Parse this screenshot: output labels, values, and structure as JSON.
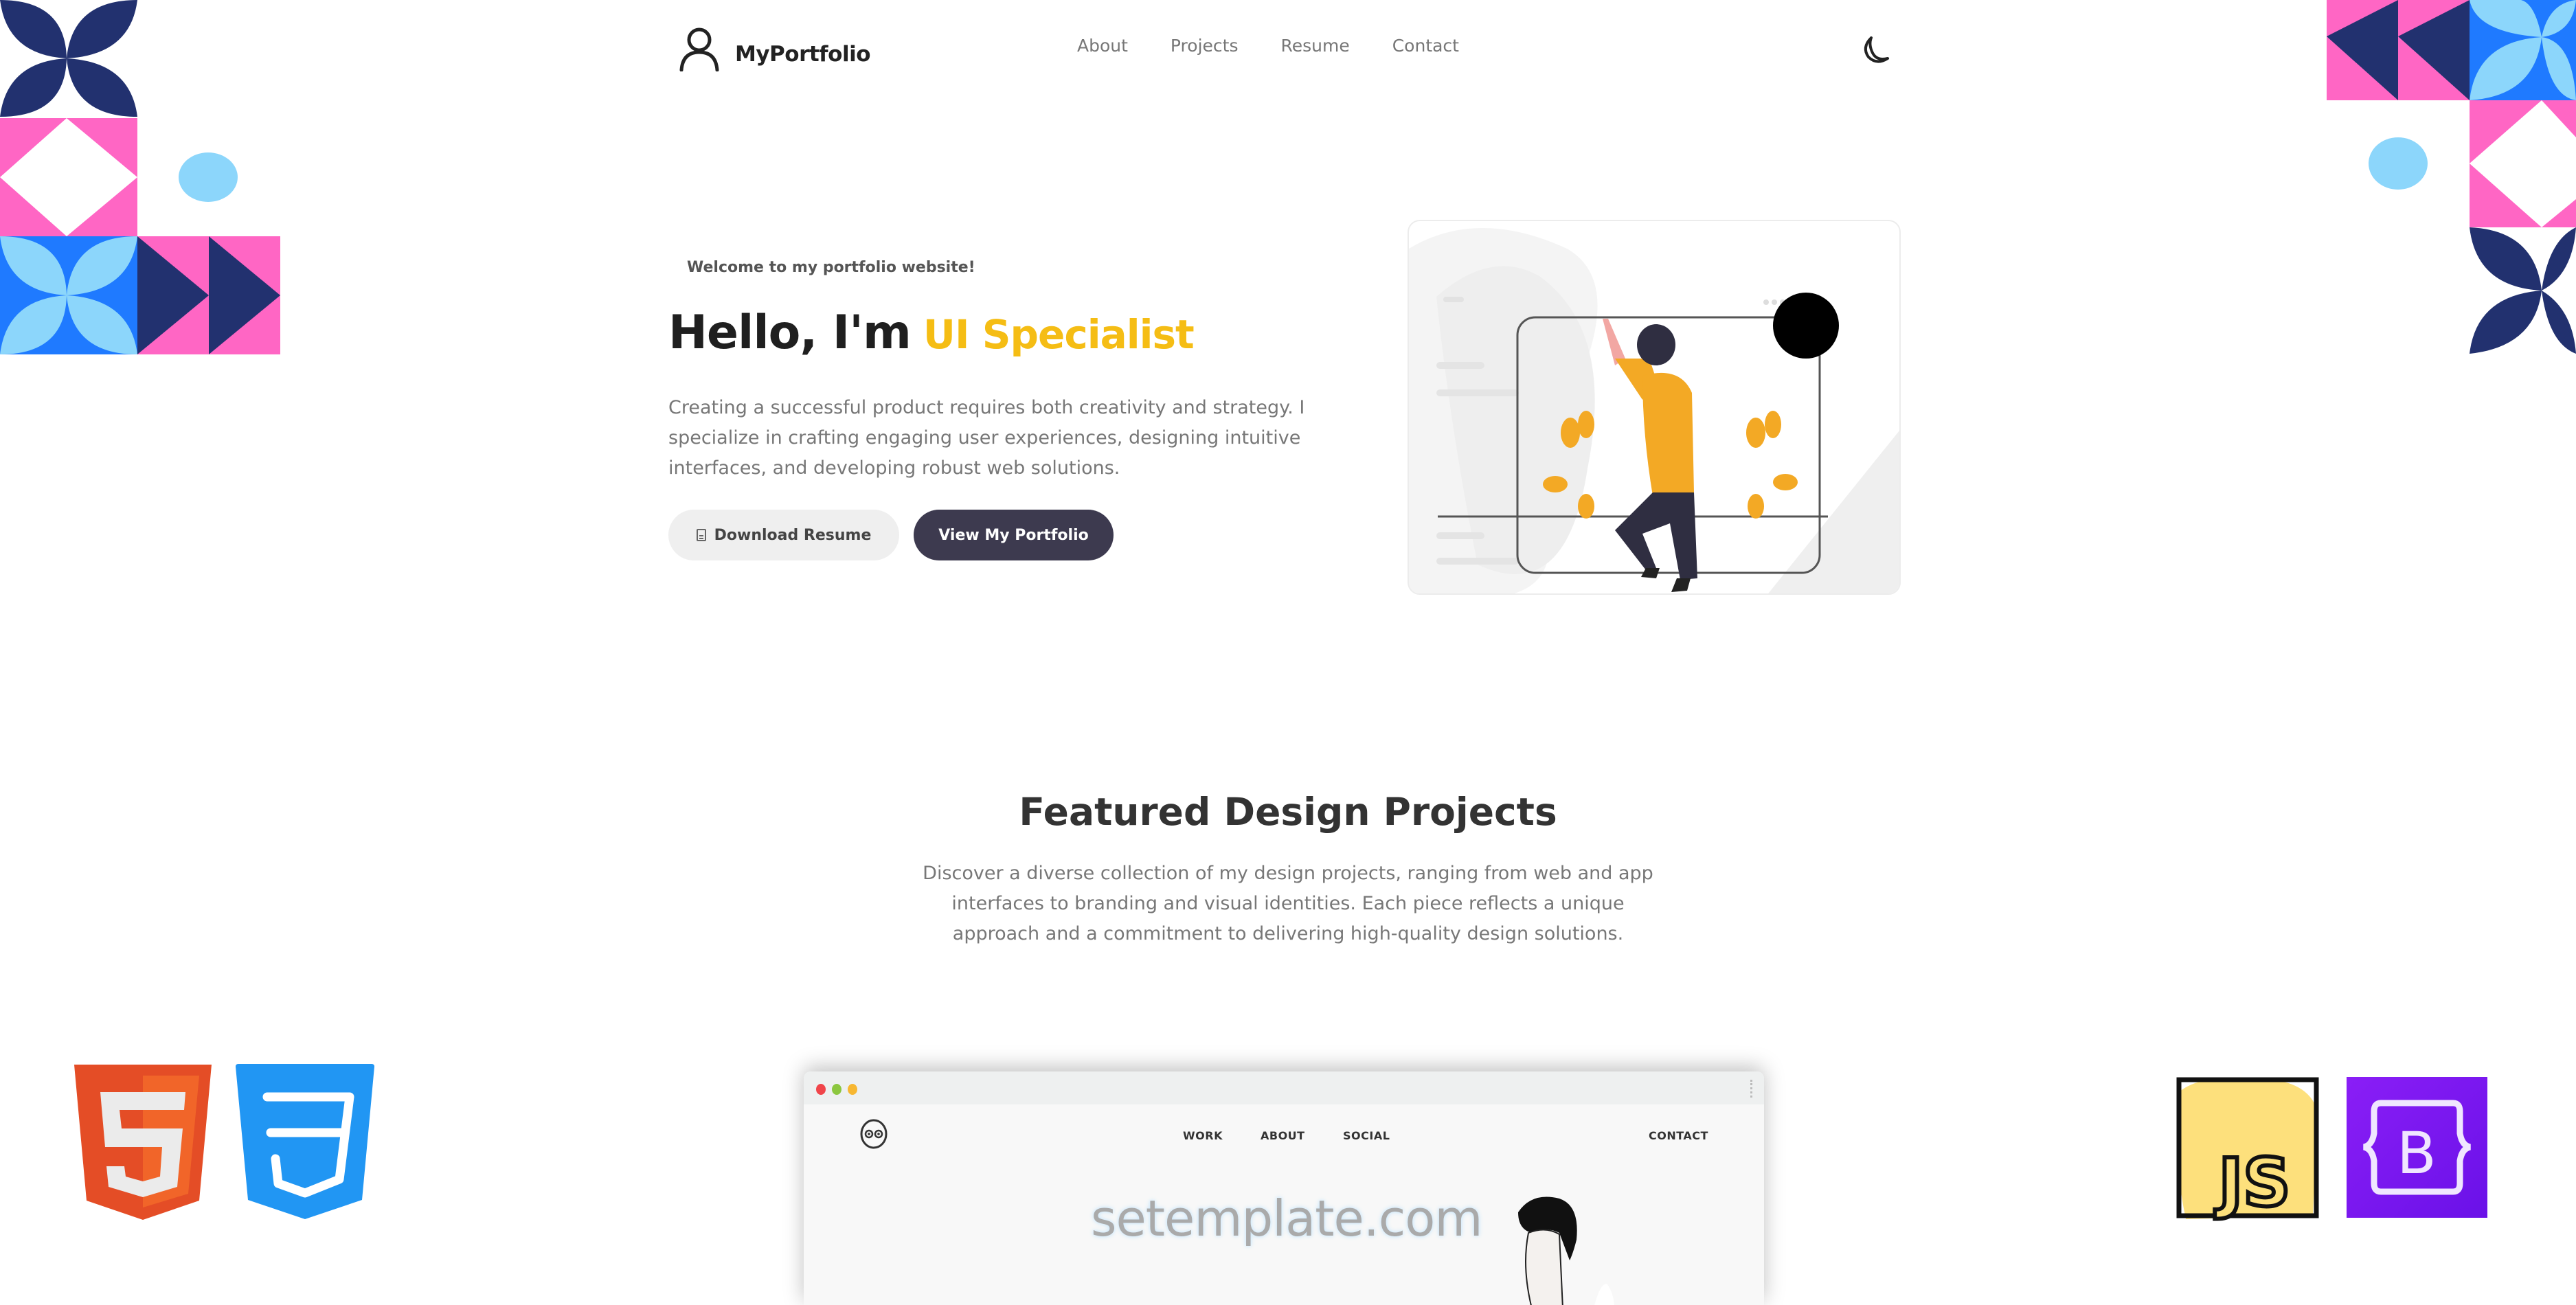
{
  "nav": {
    "brand": "MyPortfolio",
    "links": [
      "About",
      "Projects",
      "Resume",
      "Contact"
    ],
    "theme_toggle_icon": "moon-icon",
    "logo_icon": "user-icon"
  },
  "hero": {
    "welcome": "Welcome to my portfolio website!",
    "title_prefix": "Hello, I'm",
    "title_accent": "UI Specialist",
    "description": "Creating a successful product requires both creativity and strategy. I specialize in crafting engaging user experiences, designing intuitive interfaces, and developing robust web solutions.",
    "download_button": "Download Resume",
    "download_icon": "file-icon",
    "view_button": "View My Portfolio",
    "accent_color": "#f5bd14"
  },
  "featured": {
    "title": "Featured Design Projects",
    "description": "Discover a diverse collection of my design projects, ranging from web and app interfaces to branding and visual identities. Each piece reflects a unique approach and a commitment to delivering high-quality design solutions."
  },
  "mockup": {
    "nav_links": [
      "WORK",
      "ABOUT",
      "SOCIAL"
    ],
    "contact": "CONTACT",
    "logo_icon": "owl-icon"
  },
  "watermark": "setemplate.com",
  "tech_logos": {
    "html": "5",
    "js": "JS",
    "bootstrap": "B"
  },
  "colors": {
    "navy": "#22316f",
    "pink": "#ff66c4",
    "blue": "#1f7aff",
    "light_blue": "#8cd6fb",
    "button_dark": "#3d3a4f"
  }
}
